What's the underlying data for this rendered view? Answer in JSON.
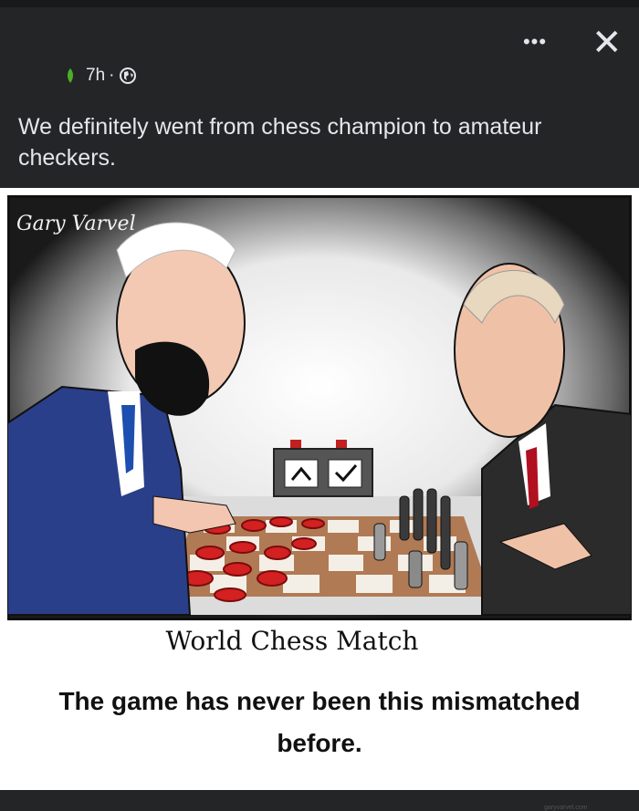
{
  "post": {
    "time": "7h",
    "separator": "·",
    "caption": "We definitely went from chess champion to amateur checkers."
  },
  "icons": {
    "more": "more-options-icon",
    "close": "close-icon",
    "leaf": "leaf-icon",
    "audience": "globe-icon"
  },
  "meme": {
    "signature": "Gary Varvel",
    "cartoon_title": "World Chess Match",
    "credit": "garyvarvel.com",
    "bottom_text": "The game has never been this mismatched before."
  },
  "colors": {
    "background": "#242526",
    "text": "#e4e6eb",
    "leaf": "#4caf2a"
  }
}
